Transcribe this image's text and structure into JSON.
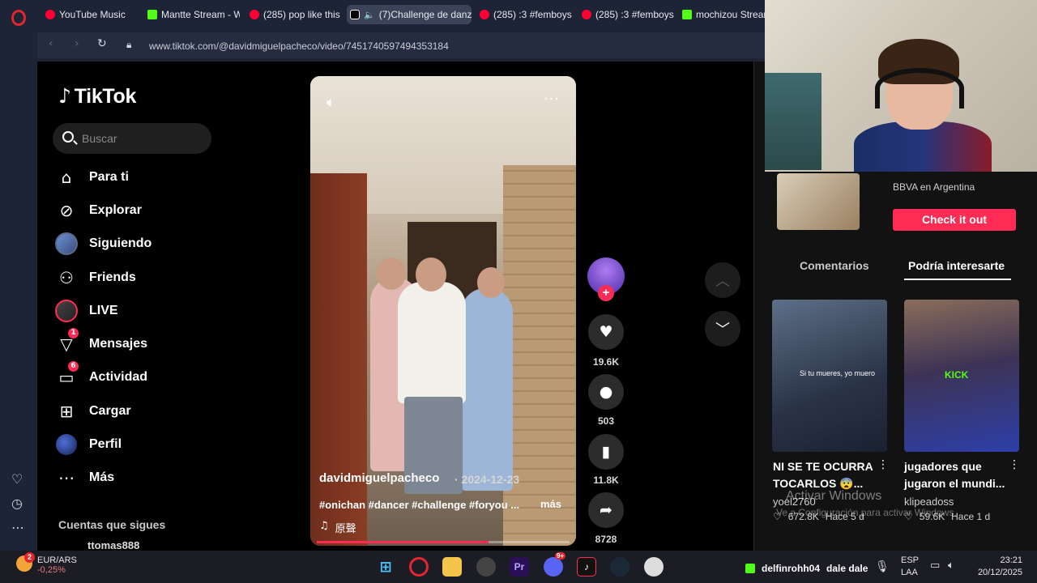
{
  "browser": {
    "tabs": [
      {
        "label": "YouTube Music",
        "icon": "youtube-icon"
      },
      {
        "label": "Mantte Stream - W",
        "icon": "kick-icon"
      },
      {
        "label": "(285) pop like this",
        "icon": "youtube-icon"
      },
      {
        "label": "(7)Challenge de danz",
        "icon": "tiktok-icon"
      },
      {
        "label": "(285) :3 #femboys",
        "icon": "youtube-icon"
      },
      {
        "label": "(285) :3 #femboys",
        "icon": "youtube-icon"
      },
      {
        "label": "mochizou Stream",
        "icon": "kick-icon"
      }
    ],
    "url": "www.tiktok.com/@davidmiguelpacheco/video/7451740597494353184"
  },
  "tiktok": {
    "logo": "TikTok",
    "search_placeholder": "Buscar",
    "nav": [
      {
        "label": "Para ti",
        "icon": "home-icon"
      },
      {
        "label": "Explorar",
        "icon": "compass-icon"
      },
      {
        "label": "Siguiendo",
        "icon": "following-avatar"
      },
      {
        "label": "Friends",
        "icon": "friends-icon"
      },
      {
        "label": "LIVE",
        "icon": "live-avatar"
      },
      {
        "label": "Mensajes",
        "icon": "messages-icon",
        "badge": "1"
      },
      {
        "label": "Actividad",
        "icon": "activity-icon",
        "badge": "6"
      },
      {
        "label": "Cargar",
        "icon": "upload-icon"
      },
      {
        "label": "Perfil",
        "icon": "profile-avatar"
      },
      {
        "label": "Más",
        "icon": "more-icon"
      }
    ],
    "following_accounts_label": "Cuentas que sigues",
    "following_first": "ttomas888"
  },
  "video": {
    "author": "davidmiguelpacheco",
    "date": "· 2024-12-23",
    "description": "#onichan #dancer #challenge #foryou ...",
    "more_link": "más",
    "music": "原聲",
    "progress": 0.68,
    "likes": "19.6K",
    "comments": "503",
    "saves": "11.8K",
    "shares": "8728"
  },
  "right_panel": {
    "ad_text": "BBVA en Argentina",
    "ad_cta": "Check it out",
    "tabs": [
      "Comentarios",
      "Podría interesarte"
    ],
    "active_tab": 1,
    "recommendations": [
      {
        "title_1": "NI SE TE OCURRA",
        "title_2": "TOCARLOS 😨...",
        "author": "yoel2760",
        "likes": "672.8K",
        "age": "Hace 5 d",
        "caption": "Si tu mueres, yo muero"
      },
      {
        "title_1": "jugadores que",
        "title_2": "jugaron el mundi...",
        "author": "klipeadoss",
        "likes": "59.6K",
        "age": "Hace 1 d",
        "caption": "KICK"
      }
    ],
    "watermark_line1": "Activar Windows",
    "watermark_line2": "Ve a Configuración para activar Windows."
  },
  "taskbar": {
    "fx_pair": "EUR/ARS",
    "fx_change": "-0,25%",
    "fx_badge": "2",
    "discord_badge": "9+",
    "stream_user": "delfinrohh04",
    "stream_msg": "dale dale",
    "lang": "ESP",
    "layout": "LAA",
    "time": "23:21",
    "date": "20/12/2025"
  }
}
